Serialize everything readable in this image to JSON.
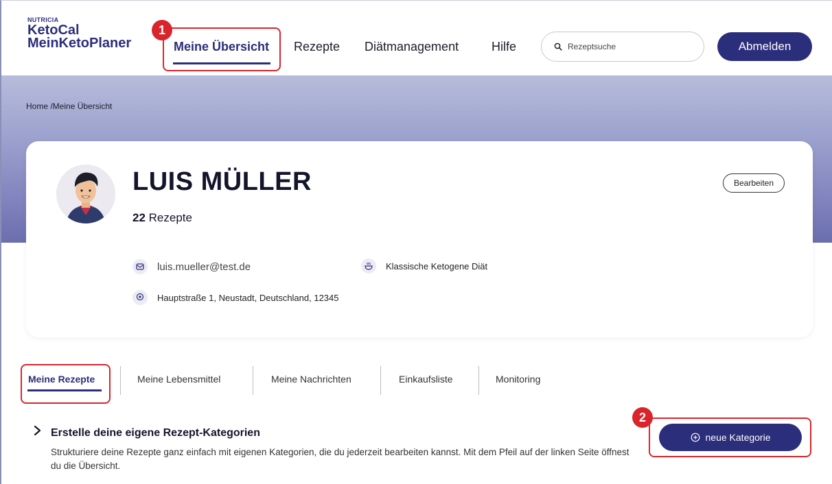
{
  "header": {
    "logo": {
      "top": "NUTRICIA",
      "mid": "KetoCal",
      "bottom": "MeinKetoPlaner"
    },
    "nav": [
      {
        "label": "Meine Übersicht",
        "active": true
      },
      {
        "label": "Rezepte"
      },
      {
        "label": "Diätmanagement"
      },
      {
        "label": "Hilfe"
      }
    ],
    "search": {
      "placeholder": "Rezeptsuche",
      "icon": "search-icon"
    },
    "logout_label": "Abmelden"
  },
  "breadcrumb": "Home /Meine Übersicht",
  "profile": {
    "name": "LUIS MÜLLER",
    "recipe_count": "22",
    "recipe_label": "Rezepte",
    "edit_label": "Bearbeiten",
    "email": "luis.mueller@test.de",
    "diet": "Klassische Ketogene Diät",
    "address": "Hauptstraße 1, Neustadt, Deutschland, 12345"
  },
  "tabs": [
    {
      "label": "Meine Rezepte",
      "active": true
    },
    {
      "label": "Meine Lebensmittel"
    },
    {
      "label": "Meine Nachrichten"
    },
    {
      "label": "Einkaufsliste"
    },
    {
      "label": "Monitoring"
    }
  ],
  "category_section": {
    "title": "Erstelle deine eigene Rezept-Kategorien",
    "description": "Strukturiere deine Rezepte ganz einfach mit eigenen Kategorien, die du jederzeit bearbeiten kannst. Mit dem Pfeil auf der linken Seite öffnest du die Übersicht.",
    "new_button_label": "neue Kategorie"
  },
  "annotations": [
    {
      "number": "1"
    },
    {
      "number": "2"
    }
  ],
  "colors": {
    "brand": "#2b2e7a",
    "highlight": "#d9242b",
    "band_top": "#b7bcdc",
    "band_bottom": "#6b6ead"
  }
}
